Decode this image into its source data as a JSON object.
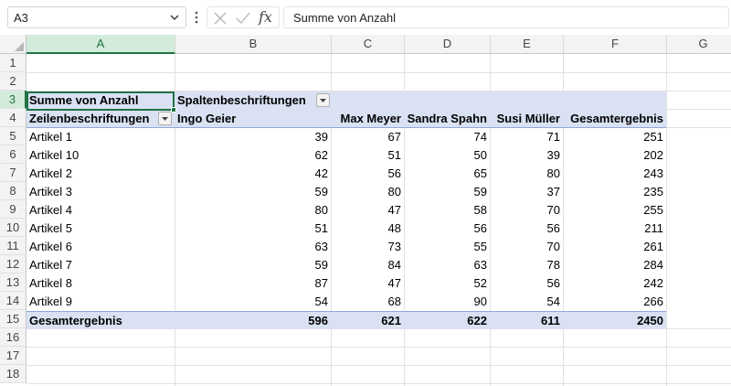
{
  "formula_bar": {
    "name_box": "A3",
    "cancel_icon": "close-icon",
    "enter_icon": "check-icon",
    "fx_label": "fx",
    "formula": "Summe von Anzahl"
  },
  "columns": [
    "A",
    "B",
    "C",
    "D",
    "E",
    "F",
    "G"
  ],
  "rows": [
    "1",
    "2",
    "3",
    "4",
    "5",
    "6",
    "7",
    "8",
    "9",
    "10",
    "11",
    "12",
    "13",
    "14",
    "15",
    "16",
    "17",
    "18"
  ],
  "selected": {
    "column": "A",
    "row": "3"
  },
  "pivot": {
    "value_field": "Summe von Anzahl",
    "column_labels": "Spaltenbeschriftungen",
    "row_labels": "Zeilenbeschriftungen",
    "headers": [
      "Ingo Geier",
      "Max Meyer",
      "Sandra Spahn",
      "Susi Müller",
      "Gesamtergebnis"
    ],
    "data_rows": [
      {
        "label": "Artikel 1",
        "values": [
          "39",
          "67",
          "74",
          "71",
          "251"
        ]
      },
      {
        "label": "Artikel 10",
        "values": [
          "62",
          "51",
          "50",
          "39",
          "202"
        ]
      },
      {
        "label": "Artikel 2",
        "values": [
          "42",
          "56",
          "65",
          "80",
          "243"
        ]
      },
      {
        "label": "Artikel 3",
        "values": [
          "59",
          "80",
          "59",
          "37",
          "235"
        ]
      },
      {
        "label": "Artikel 4",
        "values": [
          "80",
          "47",
          "58",
          "70",
          "255"
        ]
      },
      {
        "label": "Artikel 5",
        "values": [
          "51",
          "48",
          "56",
          "56",
          "211"
        ]
      },
      {
        "label": "Artikel 6",
        "values": [
          "63",
          "73",
          "55",
          "70",
          "261"
        ]
      },
      {
        "label": "Artikel 7",
        "values": [
          "59",
          "84",
          "63",
          "78",
          "284"
        ]
      },
      {
        "label": "Artikel 8",
        "values": [
          "87",
          "47",
          "52",
          "56",
          "242"
        ]
      },
      {
        "label": "Artikel 9",
        "values": [
          "54",
          "68",
          "90",
          "54",
          "266"
        ]
      }
    ],
    "total_row": {
      "label": "Gesamtergebnis",
      "values": [
        "596",
        "621",
        "622",
        "611",
        "2450"
      ]
    }
  },
  "colors": {
    "accent": "#217346",
    "pivot_band": "#d9e1f2",
    "header_bg": "#f3f3f3"
  }
}
